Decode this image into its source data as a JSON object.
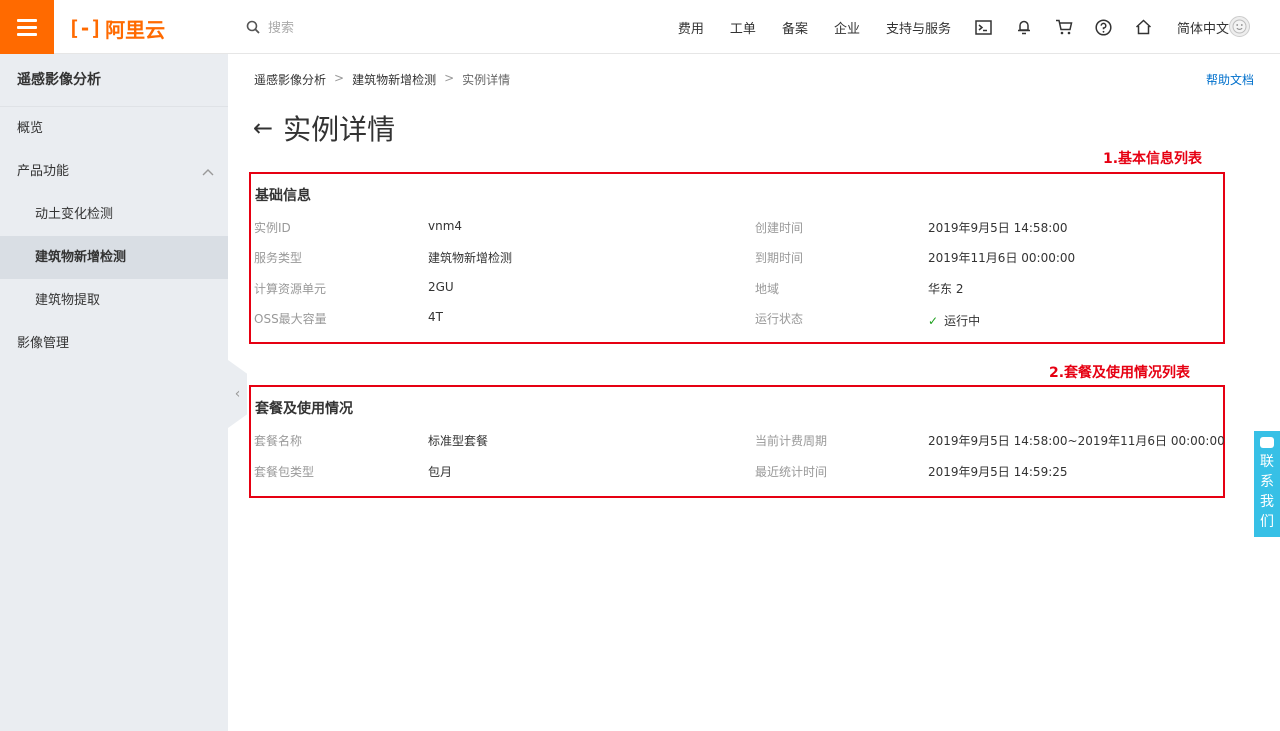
{
  "header": {
    "logo_text": "阿里云",
    "search_placeholder": "搜索",
    "nav": [
      "费用",
      "工单",
      "备案",
      "企业",
      "支持与服务"
    ],
    "language": "简体中文",
    "icons": [
      "terminal-icon",
      "bell-icon",
      "cart-icon",
      "help-circle-icon",
      "home-icon"
    ],
    "brand_color": "#ff6a00"
  },
  "sidebar": {
    "title": "遥感影像分析",
    "items": [
      {
        "label": "概览",
        "level": 1
      },
      {
        "label": "产品功能",
        "level": 1,
        "expanded": true
      },
      {
        "label": "动土变化检测",
        "level": 2
      },
      {
        "label": "建筑物新增检测",
        "level": 2,
        "active": true
      },
      {
        "label": "建筑物提取",
        "level": 2
      },
      {
        "label": "影像管理",
        "level": 1
      }
    ]
  },
  "breadcrumb": [
    "遥感影像分析",
    "建筑物新增检测",
    "实例详情"
  ],
  "help_link": "帮助文档",
  "page_title": "实例详情",
  "annotations": {
    "basic": "1.基本信息列表",
    "usage": "2.套餐及使用情况列表",
    "color": "#e60012"
  },
  "basic_info": {
    "title": "基础信息",
    "left": [
      {
        "key": "实例ID",
        "value": "vnm4"
      },
      {
        "key": "服务类型",
        "value": "建筑物新增检测"
      },
      {
        "key": "计算资源单元",
        "value": "2GU"
      },
      {
        "key": "OSS最大容量",
        "value": "4T"
      }
    ],
    "right": [
      {
        "key": "创建时间",
        "value": "2019年9月5日 14:58:00"
      },
      {
        "key": "到期时间",
        "value": "2019年11月6日 00:00:00"
      },
      {
        "key": "地域",
        "value": "华东 2"
      },
      {
        "key": "运行状态",
        "value": "运行中"
      }
    ]
  },
  "package_info": {
    "title": "套餐及使用情况",
    "left": [
      {
        "key": "套餐名称",
        "value": "标准型套餐"
      },
      {
        "key": "套餐包类型",
        "value": "包月"
      }
    ],
    "right": [
      {
        "key": "当前计费周期",
        "value": "2019年9月5日 14:58:00~2019年11月6日 00:00:00"
      },
      {
        "key": "最近统计时间",
        "value": "2019年9月5日 14:59:25"
      }
    ]
  },
  "contact_widget": {
    "text": "联系我们"
  }
}
